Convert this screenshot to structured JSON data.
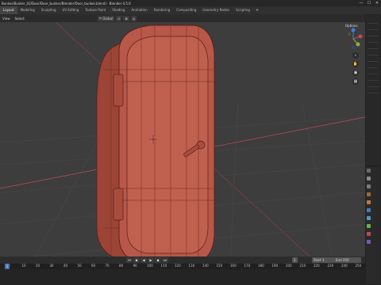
{
  "window": {
    "title": "Bunker/Bunker_02/Door/Door_bunker/Blender/Door_bunker.blend] - Blender 4.5.0",
    "controls": [
      "—",
      "☐",
      "✕"
    ]
  },
  "tabs": [
    {
      "label": "Layout",
      "active": true
    },
    {
      "label": "Modeling",
      "active": false
    },
    {
      "label": "Sculpting",
      "active": false
    },
    {
      "label": "UV Editing",
      "active": false
    },
    {
      "label": "Texture Paint",
      "active": false
    },
    {
      "label": "Shading",
      "active": false
    },
    {
      "label": "Animation",
      "active": false
    },
    {
      "label": "Rendering",
      "active": false
    },
    {
      "label": "Compositing",
      "active": false
    },
    {
      "label": "Geometry Nodes",
      "active": false
    },
    {
      "label": "Scripting",
      "active": false
    }
  ],
  "tab_add": "+",
  "header": {
    "view": "View",
    "select": "Select",
    "orientation": "Global",
    "options": "Options"
  },
  "timeline": {
    "current_frame": "1",
    "start_label": "Start",
    "start_value": "1",
    "end_label": "End",
    "end_value": "250",
    "ticks": [
      "0",
      "10",
      "20",
      "30",
      "40",
      "50",
      "60",
      "70",
      "80",
      "90",
      "100",
      "110",
      "120",
      "130",
      "140",
      "150",
      "160",
      "170",
      "180",
      "190",
      "200",
      "210",
      "220",
      "230",
      "240",
      "250"
    ],
    "playhead": "1"
  },
  "gizmo": {
    "x": "X",
    "y": "Y",
    "z": "Z"
  },
  "icons": {
    "zoom": "zoom-icon",
    "pan": "hand-icon",
    "camera": "camera-icon",
    "grid": "grid-icon"
  },
  "colors": {
    "viewport_bg": "#3d3d3d",
    "door_fill": "#b8584a",
    "door_wire": "#5a1f18",
    "axis_x": "#c24a5a",
    "axis_y": "#8ab13d",
    "axis_z": "#3f7fd8",
    "active_tab": "#4772b3"
  }
}
